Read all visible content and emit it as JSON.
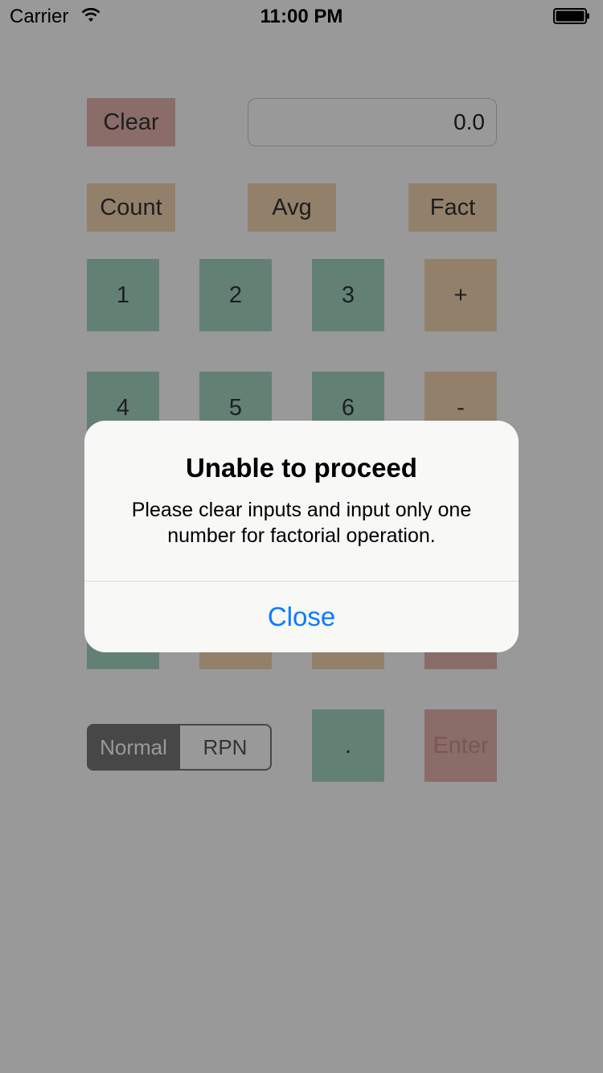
{
  "status_bar": {
    "carrier": "Carrier",
    "time": "11:00 PM"
  },
  "calculator": {
    "clear_label": "Clear",
    "display_value": "0.0",
    "function_buttons": [
      "Count",
      "Avg",
      "Fact"
    ],
    "rows": [
      [
        "1",
        "2",
        "3",
        "+"
      ],
      [
        "4",
        "5",
        "6",
        "-"
      ]
    ],
    "mode": {
      "options": [
        "Normal",
        "RPN"
      ],
      "selected": "Normal"
    },
    "dot_label": ".",
    "enter_label": "Enter"
  },
  "alert": {
    "title": "Unable to proceed",
    "message": "Please clear inputs and input only one number for factorial operation.",
    "button_label": "Close"
  },
  "colors": {
    "red_button": "#e6b5b0",
    "orange_button": "#f3d6b3",
    "green_button": "#a6d6c4",
    "alert_accent": "#0a7aff"
  }
}
